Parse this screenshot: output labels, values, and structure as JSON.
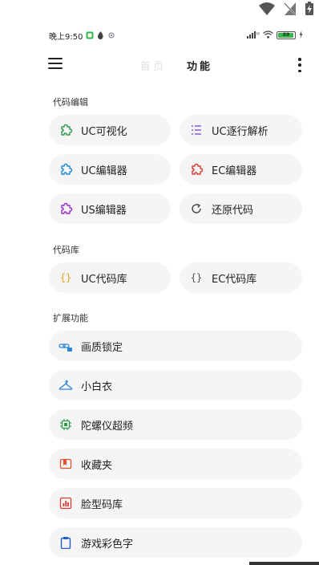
{
  "status": {
    "time": "晚上9:50",
    "battery": "89"
  },
  "appbar": {
    "tab_home": "首页",
    "tab_func": "功能"
  },
  "sections": {
    "code_edit": {
      "title": "代码编辑",
      "items": [
        {
          "label": "UC可视化",
          "icon": "puzzle-icon",
          "color": "#2e9b4e"
        },
        {
          "label": "UC逐行解析",
          "icon": "list-icon",
          "color": "#7b4fd1"
        },
        {
          "label": "UC编辑器",
          "icon": "puzzle-icon",
          "color": "#1f8ad8"
        },
        {
          "label": "EC编辑器",
          "icon": "puzzle-icon",
          "color": "#d93c2f"
        },
        {
          "label": "US编辑器",
          "icon": "puzzle-icon",
          "color": "#9b2fd1"
        },
        {
          "label": "还原代码",
          "icon": "refresh-icon",
          "color": "#444444"
        }
      ]
    },
    "code_lib": {
      "title": "代码库",
      "items": [
        {
          "label": "UC代码库",
          "icon": "braces-icon",
          "color": "#e0a21a"
        },
        {
          "label": "EC代码库",
          "icon": "braces-icon",
          "color": "#555555"
        }
      ]
    },
    "ext": {
      "title": "扩展功能",
      "items": [
        {
          "label": "画质锁定",
          "icon": "link-lock-icon",
          "color": "#2a86d6"
        },
        {
          "label": "小白衣",
          "icon": "hanger-icon",
          "color": "#2a86d6"
        },
        {
          "label": "陀螺仪超频",
          "icon": "chip-icon",
          "color": "#2e9b4e"
        },
        {
          "label": "收藏夹",
          "icon": "bookmark-box-icon",
          "color": "#e2522b"
        },
        {
          "label": "脸型码库",
          "icon": "chart-box-icon",
          "color": "#d93c2f"
        },
        {
          "label": "游戏彩色字",
          "icon": "clipboard-icon",
          "color": "#1f5fbf"
        }
      ]
    }
  }
}
